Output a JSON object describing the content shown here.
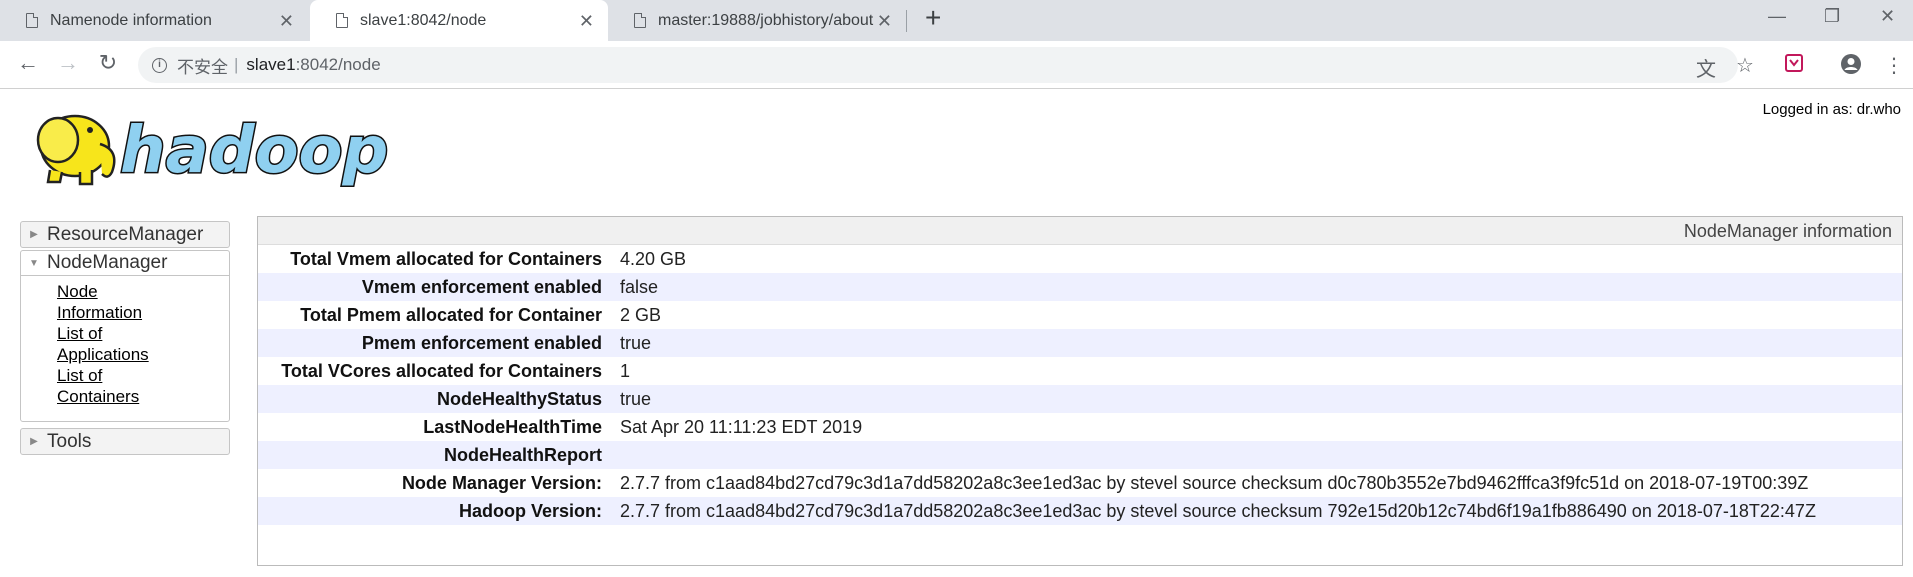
{
  "browser": {
    "tabs": [
      {
        "title": "Namenode information",
        "active": false
      },
      {
        "title": "slave1:8042/node",
        "active": true
      },
      {
        "title": "master:19888/jobhistory/about",
        "active": false
      }
    ],
    "new_tab": "+",
    "window_controls": {
      "minimize": "—",
      "restore": "❐",
      "close": "✕"
    },
    "address": {
      "security_label": "不安全",
      "host": "slave1",
      "path": ":8042/node"
    }
  },
  "page": {
    "logged_in": "Logged in as: dr.who",
    "logo_text": "hadoop",
    "nav": {
      "resource_manager": "ResourceManager",
      "node_manager": "NodeManager",
      "node_manager_links": [
        "Node Information",
        "List of Applications",
        "List of Containers"
      ],
      "tools": "Tools"
    },
    "info": {
      "heading": "NodeManager information",
      "rows": [
        {
          "label": "Total Vmem allocated for Containers",
          "value": "4.20 GB"
        },
        {
          "label": "Vmem enforcement enabled",
          "value": "false"
        },
        {
          "label": "Total Pmem allocated for Container",
          "value": "2 GB"
        },
        {
          "label": "Pmem enforcement enabled",
          "value": "true"
        },
        {
          "label": "Total VCores allocated for Containers",
          "value": "1"
        },
        {
          "label": "NodeHealthyStatus",
          "value": "true"
        },
        {
          "label": "LastNodeHealthTime",
          "value": "Sat Apr 20 11:11:23 EDT 2019"
        },
        {
          "label": "NodeHealthReport",
          "value": ""
        },
        {
          "label": "Node Manager Version:",
          "value": "2.7.7 from c1aad84bd27cd79c3d1a7dd58202a8c3ee1ed3ac by stevel source checksum d0c780b3552e7bd9462fffca3f9fc51d on 2018-07-19T00:39Z"
        },
        {
          "label": "Hadoop Version:",
          "value": "2.7.7 from c1aad84bd27cd79c3d1a7dd58202a8c3ee1ed3ac by stevel source checksum 792e15d20b12c74bd6f19a1fb886490 on 2018-07-18T22:47Z"
        }
      ]
    }
  }
}
